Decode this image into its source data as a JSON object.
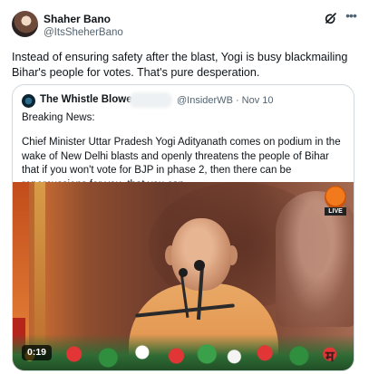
{
  "author": {
    "name": "Shaher Bano",
    "handle": "@ItsSheherBano"
  },
  "icons": {
    "grok": "grok-icon",
    "more": "more-options-icon"
  },
  "tweet": {
    "text": "Instead of ensuring safety after the blast, Yogi is busy blackmailing Bihar's people for votes. That's pure desperation."
  },
  "quoted": {
    "name": "The Whistle Blower",
    "handle_date": "@InsiderWB · Nov 10",
    "heading": "Breaking News:",
    "body": "Chief Minister Uttar Pradesh Yogi Adityanath comes on podium in the wake of New Delhi blasts and openly threatens the people of Bihar that if you won't vote for BJP in phase 2, then there can be repercussions for you, that you can...",
    "media": {
      "duration": "0:19",
      "live_label": "LIVE",
      "corner_text": "म"
    }
  },
  "colors": {
    "text_primary": "#0f1419",
    "text_secondary": "#536471",
    "border": "#cfd9de"
  }
}
